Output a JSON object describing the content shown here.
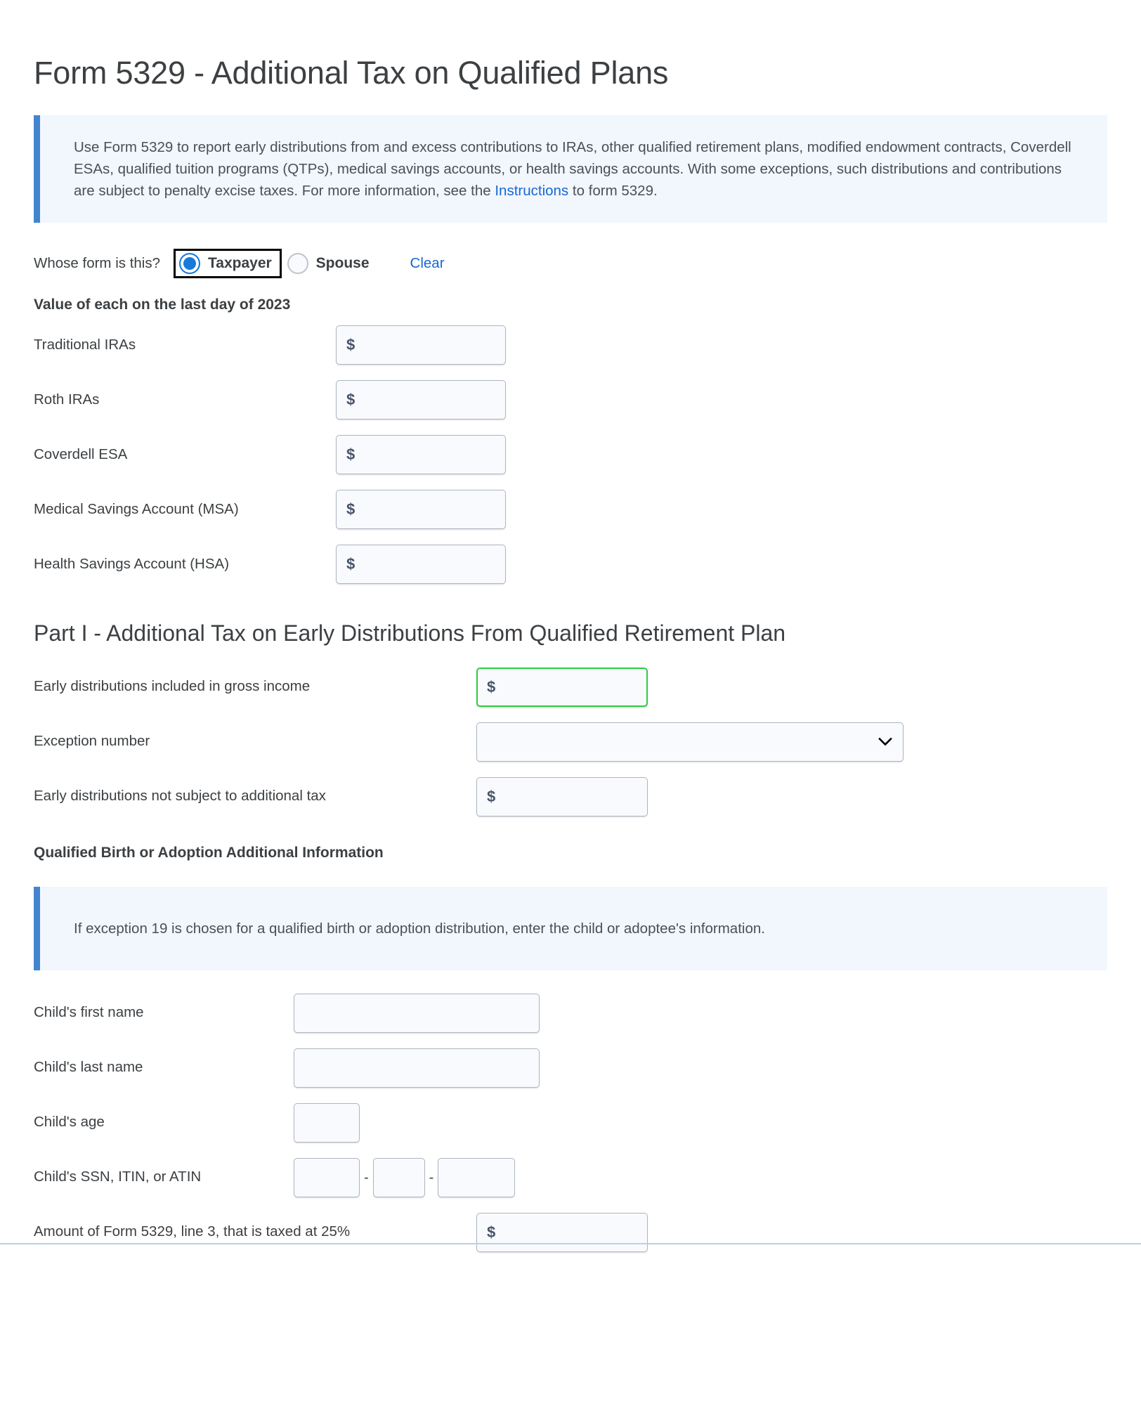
{
  "page": {
    "title": "Form 5329 - Additional Tax on Qualified Plans"
  },
  "infobox_main": {
    "text_before_link": "Use Form 5329 to report early distributions from and excess contributions to IRAs, other qualified retirement plans, modified endowment contracts, Coverdell ESAs, qualified tuition programs (QTPs), medical savings accounts, or health savings accounts. With some exceptions, such distributions and contributions are subject to penalty excise taxes. For more information, see the ",
    "link_text": "Instructions",
    "text_after_link": " to form 5329."
  },
  "whose_form": {
    "label": "Whose form is this?",
    "options": [
      {
        "label": "Taxpayer",
        "checked": true,
        "focused": true
      },
      {
        "label": "Spouse",
        "checked": false,
        "focused": false
      }
    ],
    "clear_label": "Clear"
  },
  "value_section": {
    "heading": "Value of each on the last day of 2023",
    "currency_symbol": "$",
    "fields": [
      {
        "label": "Traditional IRAs",
        "value": ""
      },
      {
        "label": "Roth IRAs",
        "value": ""
      },
      {
        "label": "Coverdell ESA",
        "value": ""
      },
      {
        "label": "Medical Savings Account (MSA)",
        "value": ""
      },
      {
        "label": "Health Savings Account (HSA)",
        "value": ""
      }
    ]
  },
  "part_one": {
    "heading": "Part I - Additional Tax on Early Distributions From Qualified Retirement Plan",
    "early_distributions_label": "Early distributions included in gross income",
    "early_distributions_value": "",
    "exception_number_label": "Exception number",
    "exception_number_value": "",
    "exception_number_options": [
      ""
    ],
    "not_subject_label": "Early distributions not subject to additional tax",
    "not_subject_value": "",
    "currency_symbol": "$",
    "chevron_icon": "chevron-down-icon"
  },
  "birth_adoption": {
    "heading": "Qualified Birth or Adoption Additional Information",
    "infobox_text": "If exception 19 is chosen for a qualified birth or adoption distribution, enter the child or adoptee's information.",
    "child_first_name_label": "Child's first name",
    "child_first_name_value": "",
    "child_last_name_label": "Child's last name",
    "child_last_name_value": "",
    "child_age_label": "Child's age",
    "child_age_value": "",
    "child_ssn_label": "Child's SSN, ITIN, or ATIN",
    "child_ssn_part1": "",
    "child_ssn_part2": "",
    "child_ssn_part3": "",
    "ssn_separator": "-",
    "taxed_25_label": "Amount of Form 5329, line 3, that is taxed at 25%",
    "taxed_25_value": "",
    "currency_symbol": "$"
  },
  "colors": {
    "accent_blue": "#4285ce",
    "infobox_bg": "#f2f6fd",
    "link_blue": "#1668d4",
    "radio_blue": "#1a7ada",
    "valid_green": "#2ecc40",
    "input_bg": "#f8fafd",
    "input_border": "#adb5bd",
    "text": "#3c4043"
  }
}
